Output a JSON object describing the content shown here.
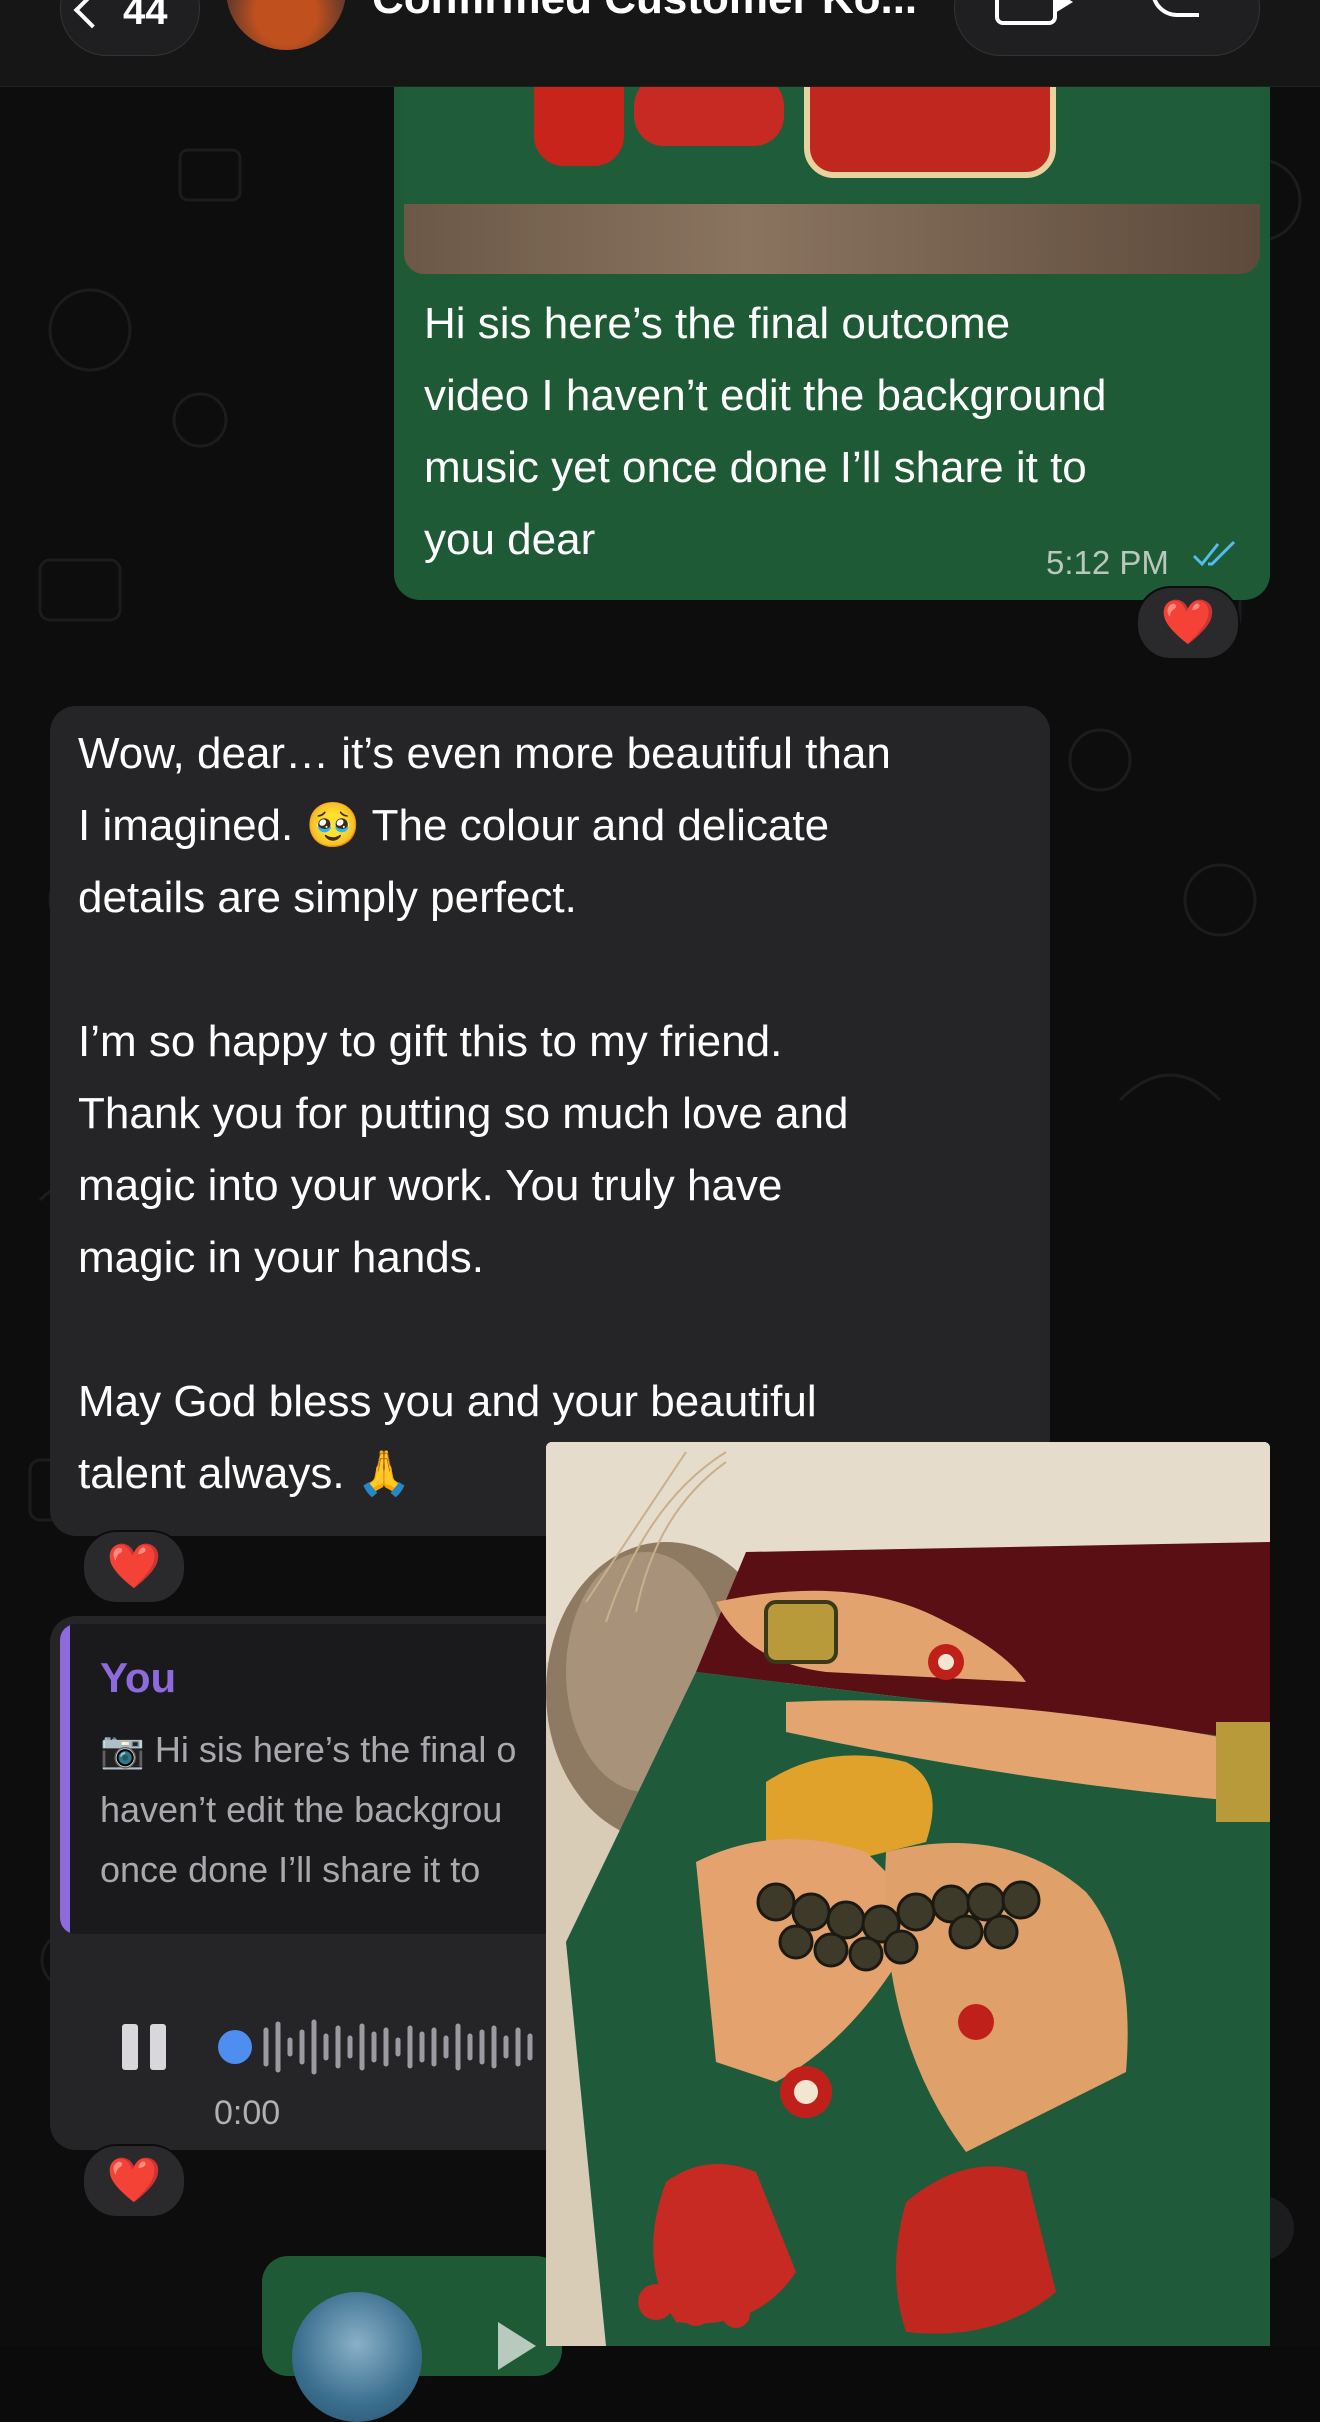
{
  "header": {
    "back_count": "44",
    "contact_name": "Confirmed Customer Ko...",
    "video_call_icon": "video-camera-icon",
    "voice_call_icon": "phone-icon"
  },
  "messages": {
    "outgoing_1": {
      "lines": [
        "Hi sis here’s the final outcome",
        "video I haven’t edit the background",
        "music yet once done I’ll share it to",
        "you dear"
      ],
      "time": "5:12 PM",
      "status_icon": "double-check-icon",
      "reaction": "❤️"
    },
    "incoming_1": {
      "lines": [
        "Wow, dear… it’s even more beautiful than",
        "I imagined. 🥹 The colour and delicate",
        "details are simply perfect.",
        "",
        "I’m so happy to gift this to my friend.",
        "Thank you for putting so much love and",
        "magic into your work. You truly have",
        "magic in your hands.",
        "",
        "May God bless you and your beautiful",
        "talent always. 🙏"
      ],
      "reaction": "❤️"
    },
    "reply": {
      "quoted_author": "You",
      "quoted_lines": [
        "📷 Hi sis here’s the final o",
        "haven’t edit the backgrou",
        "once done I’ll share it to"
      ],
      "audio_time": "0:00",
      "reaction": "❤️"
    }
  },
  "colors": {
    "outgoing_bubble": "#1f5a36",
    "incoming_bubble": "#252527",
    "accent_purple": "#8e6bdc",
    "read_ticks": "#53bdeb",
    "audio_dot": "#4d8ef0"
  }
}
